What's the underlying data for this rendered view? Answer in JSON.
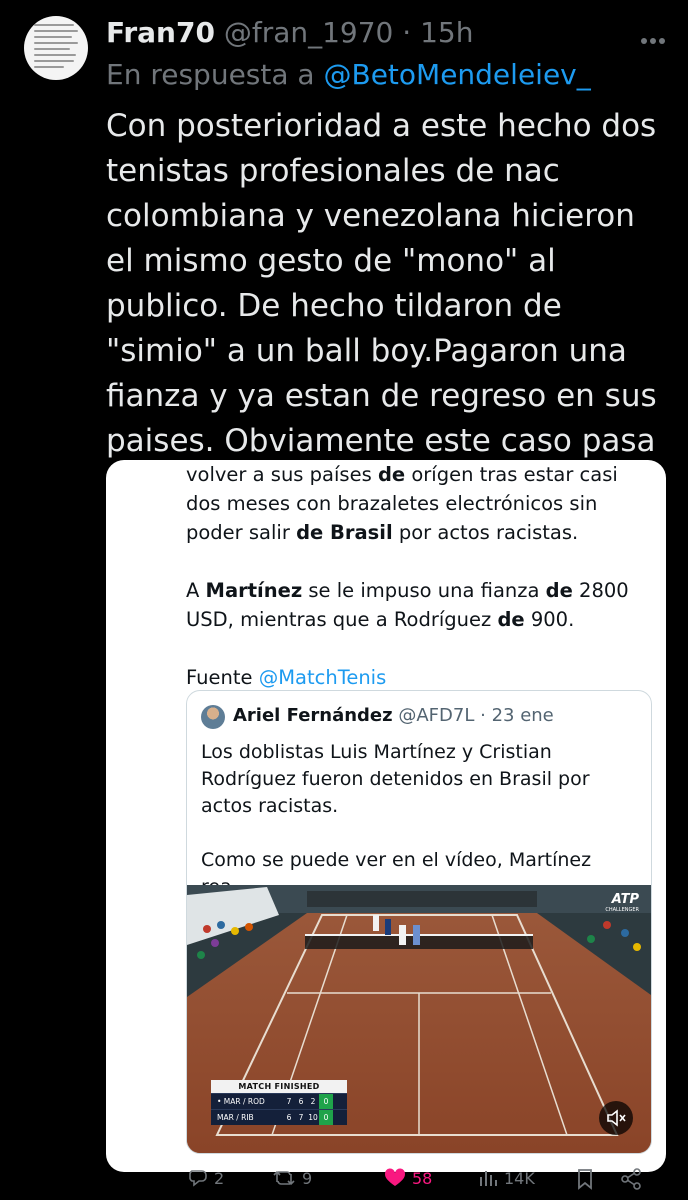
{
  "tweet": {
    "display_name": "Fran70",
    "handle": "@fran_1970",
    "separator": "·",
    "time": "15h",
    "more_icon": "more-icon",
    "reply_prefix": "En respuesta a",
    "reply_mention": "@BetoMendeleiev_",
    "text": "Con posterioridad a este hecho dos tenistas profesionales de nac colombiana y venezolana hicieron el mismo gesto de \"mono\" al publico. De hecho tildaron de \"simio\" a un ball boy.Pagaron una fianza y ya estan de regreso en sus paises. Obviamente este caso pasa porque es argentina."
  },
  "card": {
    "line1_pre": "volver a sus países ",
    "line1_b": "de",
    "line1_post": " orígen tras estar casi dos meses con brazaletes electrónicos sin poder salir ",
    "line1_b2": "de Brasil",
    "line1_end": " por actos racistas.",
    "p2_pre": "A ",
    "p2_b1": "Martínez",
    "p2_mid": " se le impuso una fianza ",
    "p2_b2": "de",
    "p2_mid2": " 2800 USD, mientras que a Rodríguez ",
    "p2_b3": "de",
    "p2_end": " 900.",
    "source_label": "Fuente",
    "source_link": "@MatchTenis"
  },
  "quote": {
    "display_name": "Ariel Fernández",
    "handle": "@AFD7L",
    "separator": "·",
    "date": "23 ene",
    "p1": "Los doblistas Luis Martínez y Cristian Rodríguez fueron detenidos en Brasil por actos racistas.",
    "p2": "Como se puede ver en el vídeo, Martínez rea...",
    "video": {
      "logo": "ATP",
      "logo_sub": "CHALLENGER",
      "scoreboard_title": "MATCH FINISHED",
      "rows": [
        {
          "team": "• MAR / ROD",
          "s1": "7",
          "s2": "6",
          "s3": "2",
          "pts": "0"
        },
        {
          "team": "MAR / RIB",
          "s1": "6",
          "s2": "7",
          "s3": "10",
          "pts": "0"
        }
      ],
      "mute_icon": "mute-icon"
    }
  },
  "actions": {
    "replies": "2",
    "retweets": "9",
    "likes": "58",
    "views": "14K"
  },
  "colors": {
    "background": "#000000",
    "text": "#e7e9ea",
    "muted": "#71767b",
    "link": "#1d9bf0",
    "like": "#f91880"
  }
}
